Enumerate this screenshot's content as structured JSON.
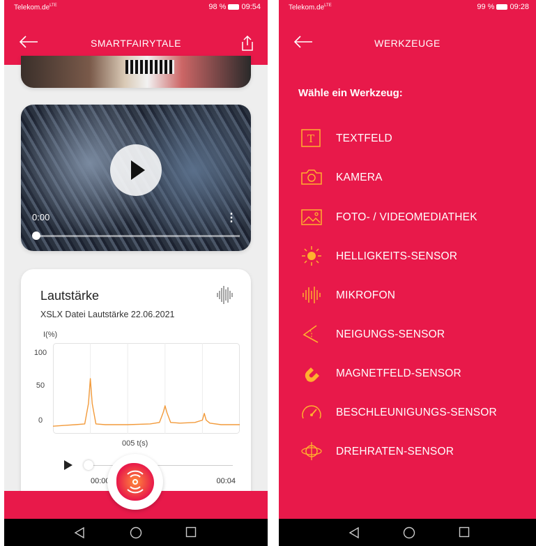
{
  "colors": {
    "brand": "#e8194a",
    "accent": "#ffb02e",
    "chart_line": "#f29a3a"
  },
  "left": {
    "status": {
      "carrier": "Telekom.de",
      "signal": "LTE",
      "battery": "98 %",
      "time": "09:54"
    },
    "appbar": {
      "title": "SMARTFAIRYTALE",
      "back_icon": "arrow-left-icon",
      "share_icon": "share-icon"
    },
    "video": {
      "time": "0:00"
    },
    "chart_card": {
      "title": "Lautstärke",
      "subtitle": "XSLX Datei Lautstärke 22.06.2021",
      "player": {
        "time_start": "00:00",
        "time_end": "00:04"
      }
    }
  },
  "right": {
    "status": {
      "carrier": "Telekom.de",
      "signal": "LTE",
      "battery": "99 %",
      "time": "09:28"
    },
    "appbar": {
      "title": "WERKZEUGE",
      "back_icon": "arrow-left-icon"
    },
    "heading": "Wähle ein Werkzeug:",
    "tools": [
      {
        "label": "TEXTFELD",
        "icon": "textfield-icon"
      },
      {
        "label": "KAMERA",
        "icon": "camera-icon"
      },
      {
        "label": "FOTO- / VIDEOMEDIATHEK",
        "icon": "image-icon"
      },
      {
        "label": "HELLIGKEITS-SENSOR",
        "icon": "sun-icon"
      },
      {
        "label": "MIKROFON",
        "icon": "waveform-icon"
      },
      {
        "label": "NEIGUNGS-SENSOR",
        "icon": "angle-icon"
      },
      {
        "label": "MAGNETFELD-SENSOR",
        "icon": "magnet-icon"
      },
      {
        "label": "BESCHLEUNIGUNGS-SENSOR",
        "icon": "speedometer-icon"
      },
      {
        "label": "DREHRATEN-SENSOR",
        "icon": "gyroscope-icon"
      }
    ]
  },
  "chart_data": {
    "type": "line",
    "ylabel": "I(%)",
    "xlabel": "005 t(s)",
    "yticks": [
      "100",
      "50",
      "0"
    ],
    "ylim": [
      -10,
      110
    ],
    "xlim": [
      0,
      5
    ],
    "series": [
      {
        "x": [
          0,
          0.3,
          0.6,
          0.85,
          0.95,
          1.0,
          1.05,
          1.15,
          1.4,
          2.0,
          2.6,
          2.85,
          2.95,
          3.0,
          3.05,
          3.15,
          3.4,
          3.8,
          4.0,
          4.05,
          4.1,
          4.2,
          4.5,
          5.0
        ],
        "y": [
          0,
          1,
          2,
          3,
          30,
          63,
          30,
          3,
          2,
          2,
          3,
          5,
          18,
          27,
          18,
          5,
          4,
          5,
          8,
          17,
          8,
          4,
          2,
          2
        ]
      }
    ]
  }
}
